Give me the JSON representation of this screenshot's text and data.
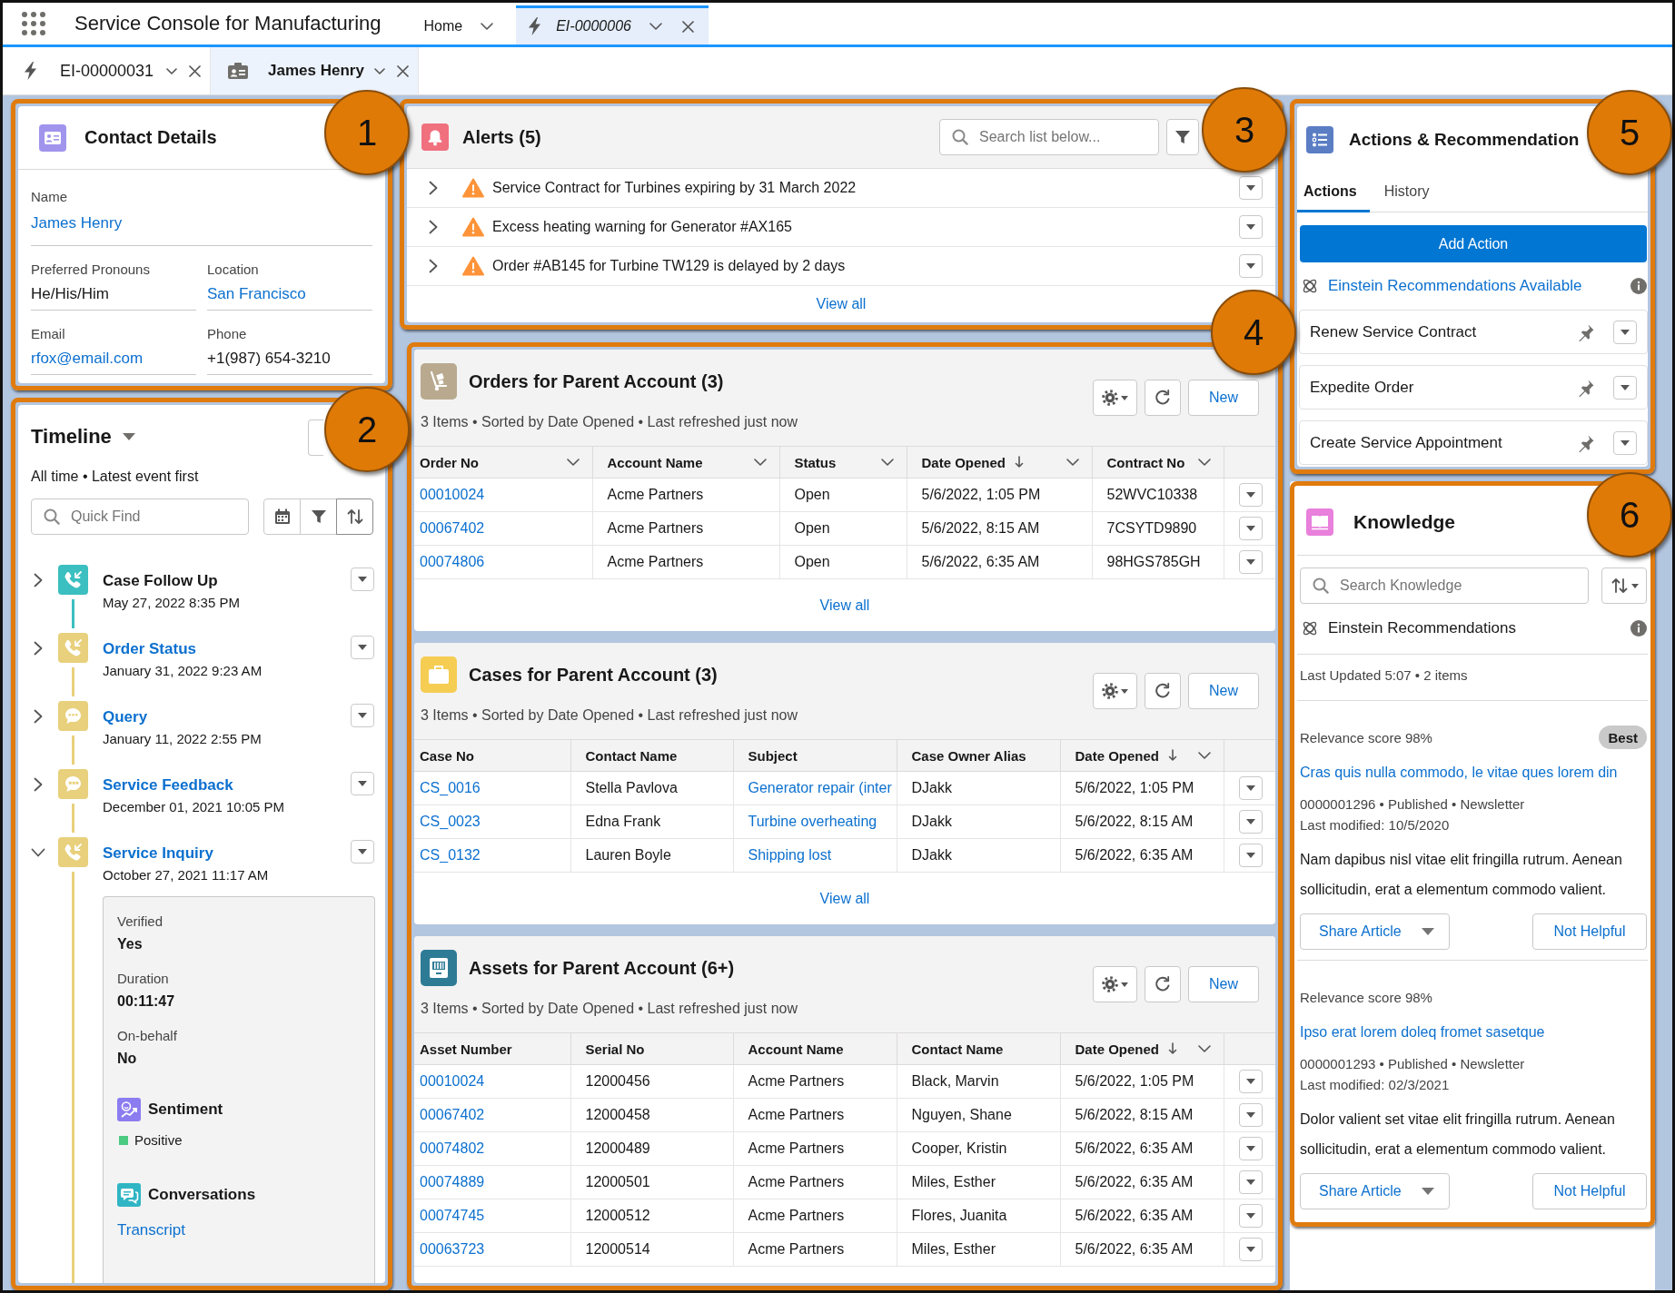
{
  "app_bar": {
    "title": "Service Console for Manufacturing",
    "tabs": [
      {
        "kind": "home",
        "label": "Home",
        "selected": false
      },
      {
        "kind": "record",
        "label": "EI-0000006",
        "selected": true
      }
    ]
  },
  "subtabs": [
    {
      "kind": "event",
      "label": "EI-00000031",
      "selected": false
    },
    {
      "kind": "contact",
      "label": "James Henry",
      "selected": true
    }
  ],
  "contact_details": {
    "title": "Contact Details",
    "fields": [
      {
        "label": "Name",
        "value": "James Henry",
        "link": true
      },
      {
        "label": "Preferred Pronouns",
        "value": "He/His/Him",
        "link": false
      },
      {
        "label": "Location",
        "value": "San Francisco",
        "link": true
      },
      {
        "label": "Email",
        "value": "rfox@email.com",
        "link": true
      },
      {
        "label": "Phone",
        "value": "+1(987) 654-3210",
        "link": false
      }
    ]
  },
  "timeline": {
    "title": "Timeline",
    "subtitle": "All time • Latest event first",
    "search": {
      "placeholder": "Quick Find"
    },
    "items": [
      {
        "kind": "call",
        "color": "#3bbfc0",
        "title": "Case Follow Up",
        "link": false,
        "date": "May 27, 2022 8:35 PM",
        "expanded": false
      },
      {
        "kind": "call",
        "color": "#e8d07c",
        "title": "Order Status",
        "link": true,
        "date": "January 31, 2022 9:23 AM",
        "expanded": false
      },
      {
        "kind": "chat",
        "color": "#e8d07c",
        "title": "Query",
        "link": true,
        "date": "January 11, 2022 2:55 PM",
        "expanded": false
      },
      {
        "kind": "sms",
        "color": "#e8d07c",
        "title": "Service Feedback",
        "link": true,
        "date": "December 01, 2021 10:05 PM",
        "expanded": false
      },
      {
        "kind": "call",
        "color": "#e8d07c",
        "title": "Service Inquiry",
        "link": true,
        "date": "October 27, 2021 11:17 AM",
        "expanded": true,
        "details": {
          "fields": [
            {
              "label": "Verified",
              "value": "Yes"
            },
            {
              "label": "Duration",
              "value": "00:11:47"
            },
            {
              "label": "On-behalf",
              "value": "No"
            }
          ],
          "sections": [
            {
              "kind": "sentiment",
              "title": "Sentiment",
              "value": "Positive"
            },
            {
              "kind": "conversations",
              "title": "Conversations",
              "link_text": "Transcript"
            }
          ]
        }
      }
    ]
  },
  "alerts": {
    "title": "Alerts (5)",
    "search": {
      "placeholder": "Search list below..."
    },
    "items": [
      {
        "text": "Service Contract for Turbines expiring by 31 March 2022",
        "expanded": false
      },
      {
        "text": "Excess heating warning for Generator #AX165",
        "expanded": false
      },
      {
        "text": "Order #AB145 for Turbine TW129 is delayed by 2 days",
        "expanded": false
      }
    ],
    "view_all": "View all"
  },
  "related_lists": [
    {
      "kind": "orders",
      "title": "Orders for Parent Account (3)",
      "new_label": "New",
      "subtitle": "3 Items • Sorted by Date Opened • Last refreshed just now",
      "columns": [
        {
          "label": "Order No",
          "link": true,
          "sorted": false,
          "menu": true
        },
        {
          "label": "Account Name",
          "link": false,
          "sorted": false,
          "menu": true
        },
        {
          "label": "Status",
          "link": false,
          "sorted": false,
          "menu": true
        },
        {
          "label": "Date Opened",
          "link": false,
          "sorted": true,
          "menu": true
        },
        {
          "label": "Contract No",
          "link": false,
          "sorted": false,
          "menu": true
        }
      ],
      "rows": [
        [
          "00010024",
          "Acme Partners",
          "Open",
          "5/6/2022, 1:05 PM",
          "52WVC10338"
        ],
        [
          "00067402",
          "Acme Partners",
          "Open",
          "5/6/2022, 8:15 AM",
          "7CSYTD9890"
        ],
        [
          "00074806",
          "Acme Partners",
          "Open",
          "5/6/2022, 6:35 AM",
          "98HGS785GH"
        ]
      ],
      "view_all": "View all"
    },
    {
      "kind": "cases",
      "title": "Cases for Parent Account (3)",
      "new_label": "New",
      "subtitle": "3 Items • Sorted by Date Opened • Last refreshed just now",
      "columns": [
        {
          "label": "Case No",
          "link": true,
          "sorted": false,
          "menu": false
        },
        {
          "label": "Contact Name",
          "link": false,
          "sorted": false,
          "menu": false
        },
        {
          "label": "Subject",
          "link": true,
          "sorted": false,
          "menu": false
        },
        {
          "label": "Case Owner Alias",
          "link": false,
          "sorted": false,
          "menu": false
        },
        {
          "label": "Date Opened",
          "link": false,
          "sorted": true,
          "menu": true
        }
      ],
      "rows": [
        [
          "CS_0016",
          "Stella Pavlova",
          "Generator repair (inter",
          "DJakk",
          "5/6/2022, 1:05 PM"
        ],
        [
          "CS_0023",
          "Edna Frank",
          "Turbine overheating",
          "DJakk",
          "5/6/2022, 8:15 AM"
        ],
        [
          "CS_0132",
          "Lauren Boyle",
          "Shipping lost",
          "DJakk",
          "5/6/2022, 6:35 AM"
        ]
      ],
      "view_all": "View all"
    },
    {
      "kind": "assets",
      "title": "Assets for Parent Account (6+)",
      "new_label": "New",
      "subtitle": "3 Items • Sorted by Date Opened • Last refreshed just now",
      "columns": [
        {
          "label": "Asset Number",
          "link": true,
          "sorted": false,
          "menu": false
        },
        {
          "label": "Serial No",
          "link": false,
          "sorted": false,
          "menu": false
        },
        {
          "label": "Account Name",
          "link": false,
          "sorted": false,
          "menu": false
        },
        {
          "label": "Contact Name",
          "link": false,
          "sorted": false,
          "menu": false
        },
        {
          "label": "Date Opened",
          "link": false,
          "sorted": true,
          "menu": true
        }
      ],
      "rows": [
        [
          "00010024",
          "12000456",
          "Acme Partners",
          "Black, Marvin",
          "5/6/2022, 1:05 PM"
        ],
        [
          "00067402",
          "12000458",
          "Acme Partners",
          "Nguyen, Shane",
          "5/6/2022, 8:15 AM"
        ],
        [
          "00074802",
          "12000489",
          "Acme Partners",
          "Cooper, Kristin",
          "5/6/2022, 6:35 AM"
        ],
        [
          "00074889",
          "12000501",
          "Acme Partners",
          "Miles, Esther",
          "5/6/2022, 6:35 AM"
        ],
        [
          "00074745",
          "12000512",
          "Acme Partners",
          "Flores, Juanita",
          "5/6/2022, 6:35 AM"
        ],
        [
          "00063723",
          "12000514",
          "Acme Partners",
          "Miles, Esther",
          "5/6/2022, 6:35 AM"
        ]
      ]
    }
  ],
  "actions": {
    "title": "Actions & Recommendation",
    "tabs": [
      {
        "label": "Actions",
        "selected": true
      },
      {
        "label": "History",
        "selected": false
      }
    ],
    "add_label": "Add Action",
    "einstein_link": "Einstein Recommendations Available",
    "items": [
      "Renew Service Contract",
      "Expedite Order",
      "Create Service Appointment"
    ]
  },
  "knowledge": {
    "title": "Knowledge",
    "search": {
      "placeholder": "Search Knowledge"
    },
    "einstein_label": "Einstein Recommendations",
    "updated": "Last Updated 5:07 • 2 items",
    "articles": [
      {
        "relevance": "Relevance score 98%",
        "badge": "Best",
        "title": "Cras quis nulla commodo, le vitae ques lorem din",
        "meta": "0000001296 • Published • Newsletter",
        "modified": "Last modified: 10/5/2020",
        "body": "Nam dapibus nisl vitae elit fringilla rutrum. Aenean sollicitudin, erat a elementum commodo valient.",
        "share_label": "Share Article",
        "not_helpful_label": "Not Helpful"
      },
      {
        "relevance": "Relevance score 98%",
        "title": "Ipso erat lorem doleq fromet sasetque",
        "meta": "0000001293 • Published • Newsletter",
        "modified": "Last modified: 02/3/2021",
        "body": "Dolor valient set vitae elit fringilla rutrum. Aenean sollicitudin, erat a elementum commodo valient.",
        "share_label": "Share Article",
        "not_helpful_label": "Not Helpful"
      }
    ]
  },
  "callouts": [
    "1",
    "2",
    "3",
    "4",
    "5",
    "6"
  ]
}
